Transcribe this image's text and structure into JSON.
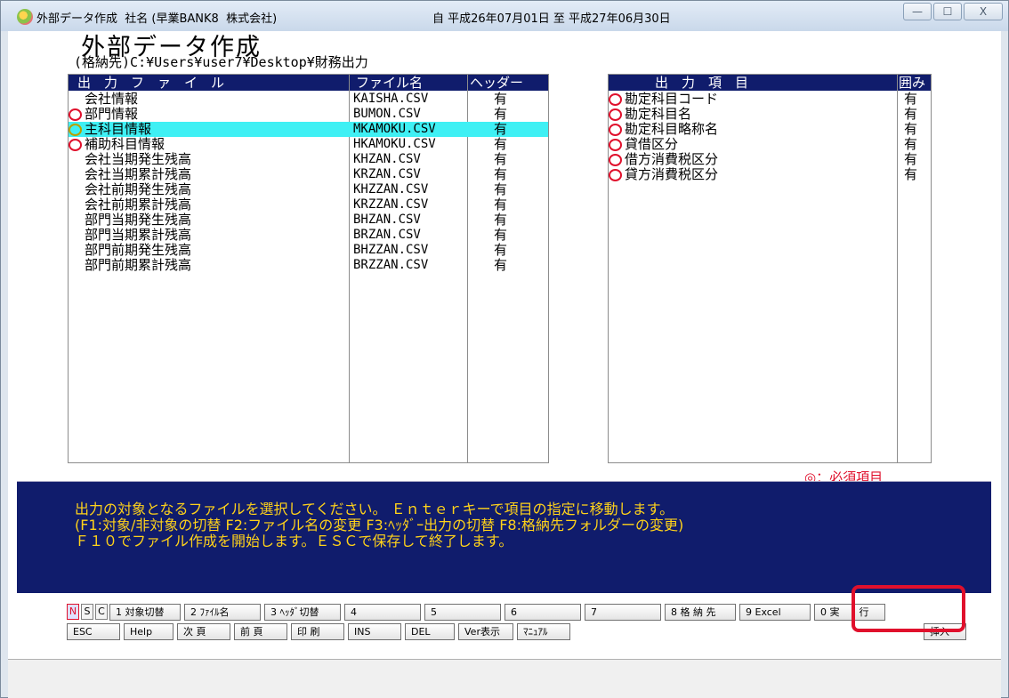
{
  "window": {
    "title": "外部データ作成  社名 (早業BANK8  株式会社)",
    "period": "自 平成26年07月01日 至 平成27年06月30日",
    "buttons": {
      "minimize": "—",
      "maximize": "☐",
      "close": "X"
    }
  },
  "heading": "外部データ作成",
  "output_path": "(格納先)C:¥Users¥user7¥Desktop¥財務出力",
  "files_panel": {
    "headers": {
      "file": "出　力　フ　ァ　イ　ル",
      "filename": "ファイル名",
      "header": "ヘッダー"
    },
    "rows": [
      {
        "name": "会社情報",
        "filename": "KAISHA.CSV",
        "header": "有",
        "mark": ""
      },
      {
        "name": "部門情報",
        "filename": "BUMON.CSV",
        "header": "有",
        "mark": "red"
      },
      {
        "name": "主科目情報",
        "filename": "MKAMOKU.CSV",
        "header": "有",
        "mark": "yellow",
        "selected": true
      },
      {
        "name": "補助科目情報",
        "filename": "HKAMOKU.CSV",
        "header": "有",
        "mark": "red"
      },
      {
        "name": "会社当期発生残高",
        "filename": "KHZAN.CSV",
        "header": "有",
        "mark": ""
      },
      {
        "name": "会社当期累計残高",
        "filename": "KRZAN.CSV",
        "header": "有",
        "mark": ""
      },
      {
        "name": "会社前期発生残高",
        "filename": "KHZZAN.CSV",
        "header": "有",
        "mark": ""
      },
      {
        "name": "会社前期累計残高",
        "filename": "KRZZAN.CSV",
        "header": "有",
        "mark": ""
      },
      {
        "name": "部門当期発生残高",
        "filename": "BHZAN.CSV",
        "header": "有",
        "mark": ""
      },
      {
        "name": "部門当期累計残高",
        "filename": "BRZAN.CSV",
        "header": "有",
        "mark": ""
      },
      {
        "name": "部門前期発生残高",
        "filename": "BHZZAN.CSV",
        "header": "有",
        "mark": ""
      },
      {
        "name": "部門前期累計残高",
        "filename": "BRZZAN.CSV",
        "header": "有",
        "mark": ""
      }
    ]
  },
  "items_panel": {
    "headers": {
      "item": "出　力　項　目",
      "enclose": "囲み"
    },
    "rows": [
      {
        "name": "勘定科目コード",
        "enclose": "有"
      },
      {
        "name": "勘定科目名",
        "enclose": "有"
      },
      {
        "name": "勘定科目略称名",
        "enclose": "有"
      },
      {
        "name": "貸借区分",
        "enclose": "有"
      },
      {
        "name": "借方消費税区分",
        "enclose": "有"
      },
      {
        "name": "貸方消費税区分",
        "enclose": "有"
      }
    ]
  },
  "required_note": "◎：必須項目",
  "message": {
    "line1": "出力の対象となるファイルを選択してください。 Ｅｎｔｅｒキーで項目の指定に移動します。",
    "line2": "(F1:対象/非対象の切替 F2:ファイル名の変更 F3:ﾍｯﾀﾞｰ出力の切替 F8:格納先フォルダーの変更)",
    "line3": "Ｆ１０でファイル作成を開始します。ＥＳＣで保存して終了します。"
  },
  "function_keys": {
    "indicators": [
      "N",
      "S",
      "C"
    ],
    "row1": [
      "1 対象切替",
      "2 ﾌｧｲﾙ名",
      "3 ﾍｯﾀﾞ切替",
      "4",
      "5",
      "6",
      "7",
      "8 格 納 先",
      "9 Excel",
      "0 実　　行"
    ],
    "row2": [
      "ESC",
      "Help",
      "次 頁",
      "前 頁",
      "印 刷",
      "INS",
      "DEL",
      "Ver表示",
      "ﾏﾆｭｱﾙ",
      "挿入"
    ]
  },
  "colors": {
    "accent_blue": "#101c6c",
    "selection": "#3ff0f4",
    "message_text": "#ffd21a",
    "required_red": "#e0102c"
  }
}
